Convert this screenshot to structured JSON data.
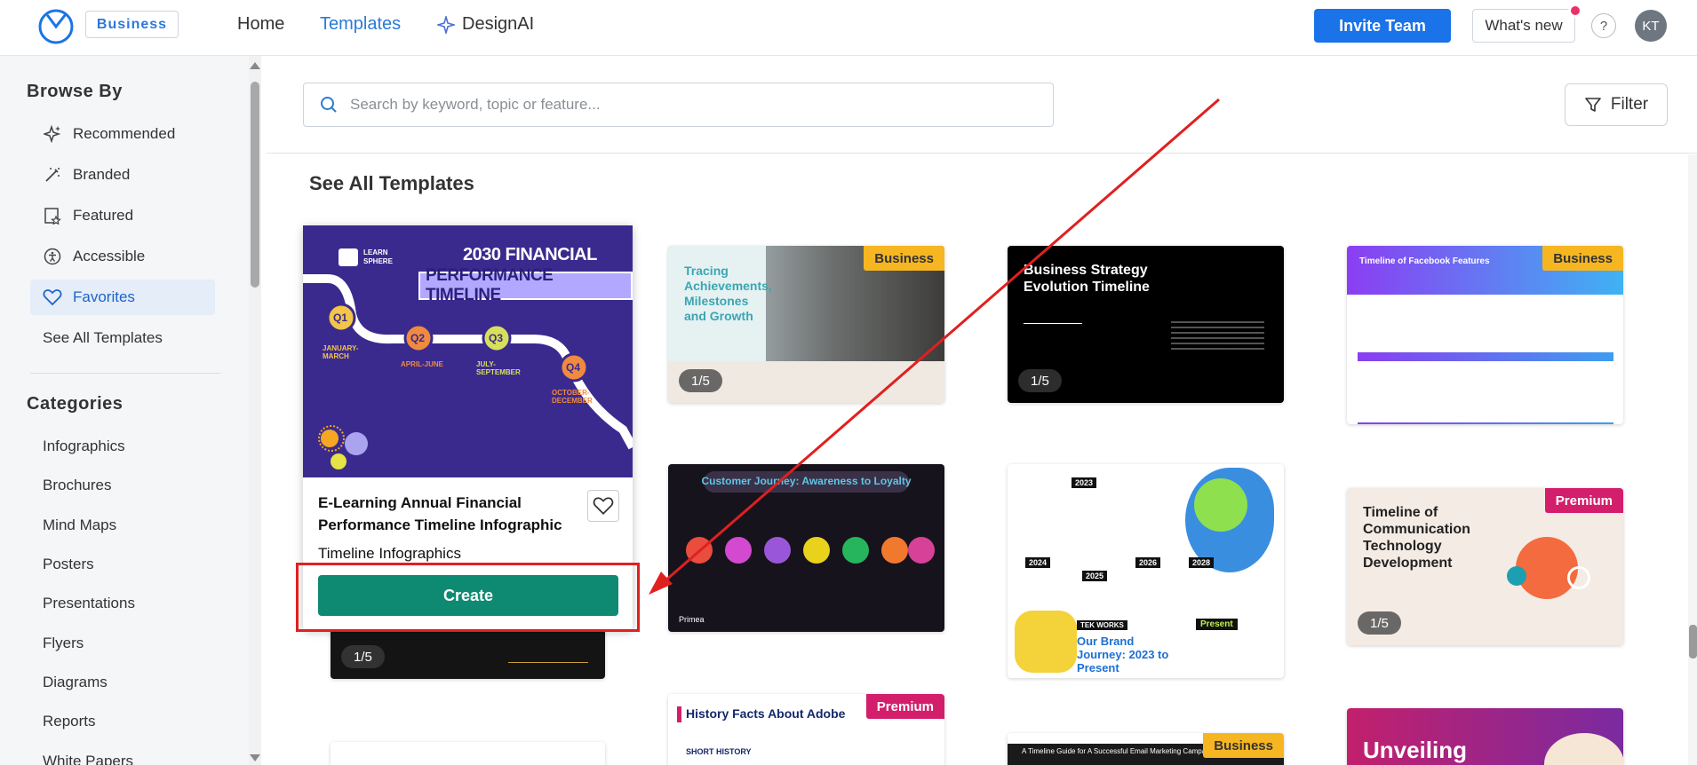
{
  "header": {
    "badge": "Business",
    "nav": {
      "home": "Home",
      "templates": "Templates",
      "designai": "DesignAI"
    },
    "invite_label": "Invite Team",
    "whats_new_label": "What's new",
    "help_label": "?",
    "avatar_initials": "KT"
  },
  "sidebar": {
    "browse_heading": "Browse By",
    "browse_items": [
      {
        "label": "Recommended",
        "icon": "sparkle-icon"
      },
      {
        "label": "Branded",
        "icon": "magic-wand-icon"
      },
      {
        "label": "Featured",
        "icon": "featured-star-icon"
      },
      {
        "label": "Accessible",
        "icon": "accessibility-icon"
      },
      {
        "label": "Favorites",
        "icon": "heart-icon",
        "active": true
      },
      {
        "label": "See All Templates",
        "icon": ""
      }
    ],
    "categories_heading": "Categories",
    "categories": [
      "Infographics",
      "Brochures",
      "Mind Maps",
      "Posters",
      "Presentations",
      "Flyers",
      "Diagrams",
      "Reports",
      "White Papers"
    ]
  },
  "search": {
    "placeholder": "Search by keyword, topic or feature..."
  },
  "filter_label": "Filter",
  "section_title": "See All Templates",
  "featured": {
    "preview_brand": "LEARN SPHERE",
    "preview_title_1": "2030 FINANCIAL",
    "preview_title_2": "PERFORMANCE TIMELINE",
    "quarters": [
      "Q1",
      "Q2",
      "Q3",
      "Q4"
    ],
    "quarter_labels": [
      "JANUARY-MARCH",
      "APRIL-JUNE",
      "JULY-SEPTEMBER",
      "OCTOBER-DECEMBER"
    ],
    "title": "E-Learning Annual Financial Performance Timeline Infographic",
    "category": "Timeline Infographics",
    "create_label": "Create",
    "page_count": "1/5"
  },
  "cards": [
    {
      "title": "Tracing Achievements, Milestones and Growth",
      "badge": "Business",
      "pages": "1/5"
    },
    {
      "title": "Business Strategy Evolution Timeline",
      "badge": "",
      "pages": "1/5"
    },
    {
      "title": "Timeline of Facebook Features",
      "badge": "Business",
      "pages": ""
    },
    {
      "title": "Customer Journey: Awareness to Loyalty",
      "badge": "",
      "pages": "",
      "footer": "Primea"
    },
    {
      "title": "Our Brand Journey: 2023 to Present",
      "badge": "",
      "pages": "",
      "brand": "TEK WORKS",
      "years": [
        "2023",
        "2024",
        "2025",
        "2026",
        "2028"
      ],
      "present": "Present"
    },
    {
      "title": "Timeline of Communication Technology Development",
      "badge": "Premium",
      "pages": "1/5"
    },
    {
      "title": "History Facts About Adobe",
      "badge": "Premium",
      "pages": "",
      "sub": "SHORT HISTORY"
    },
    {
      "title": "A Timeline Guide for A Successful Email Marketing Campaign",
      "badge": "Business",
      "pages": ""
    },
    {
      "title": "Unveiling",
      "badge": "",
      "pages": ""
    }
  ],
  "colors": {
    "accent": "#1a73e8",
    "create": "#0f8a72",
    "business": "#f6b622",
    "premium": "#d31e6c",
    "annotation": "#e0201f"
  }
}
